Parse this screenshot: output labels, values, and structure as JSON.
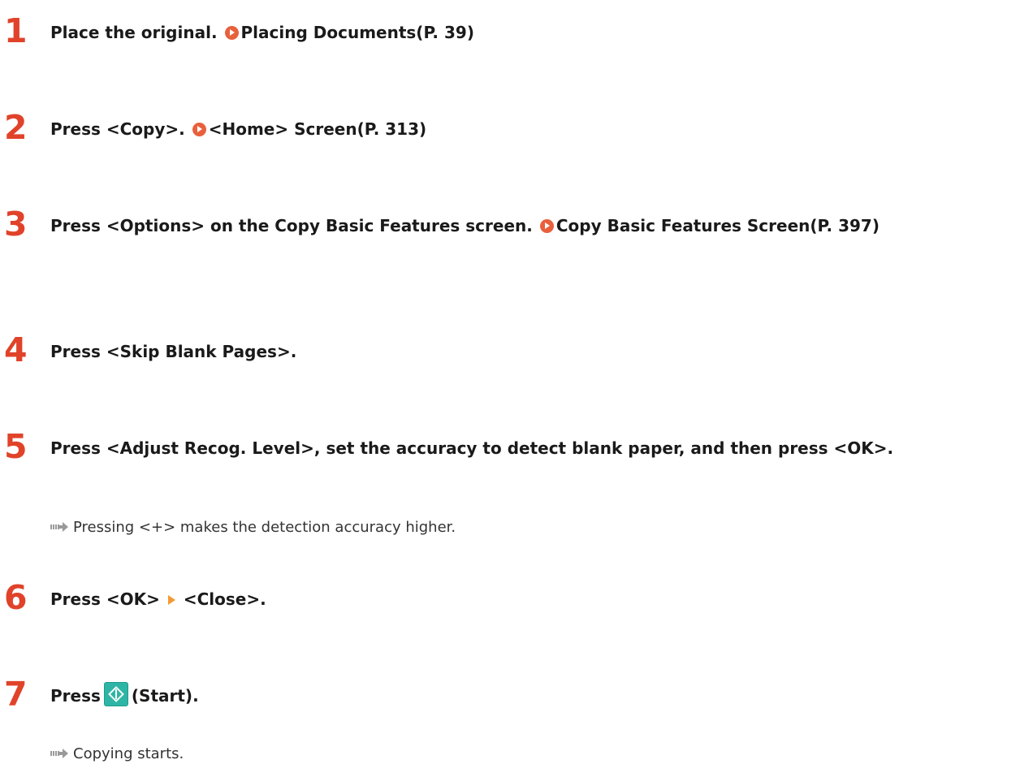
{
  "steps": [
    {
      "number": "1",
      "text": "Place the original.",
      "link": "Placing Documents(P. 39)"
    },
    {
      "number": "2",
      "text": "Press <Copy>.",
      "link": "<Home> Screen(P. 313)"
    },
    {
      "number": "3",
      "text": "Press <Options> on the Copy Basic Features screen.",
      "link": "Copy Basic Features Screen(P. 397)"
    },
    {
      "number": "4",
      "text": "Press <Skip Blank Pages>."
    },
    {
      "number": "5",
      "text": "Press <Adjust Recog. Level>, set the accuracy to detect blank paper, and then press <OK>.",
      "result": "Pressing <+> makes the detection accuracy higher."
    },
    {
      "number": "6",
      "part1": "Press <OK>",
      "part2": "<Close>."
    },
    {
      "number": "7",
      "part1": "Press",
      "part2": "(Start).",
      "result": "Copying starts."
    }
  ],
  "icons": {
    "link": "link-arrow-icon",
    "menu_separator": "menu-separator-icon",
    "start": "start-key-icon",
    "result": "result-arrow-icon"
  },
  "colors": {
    "step_number": "#e0432a",
    "link_icon": "#e8603c",
    "separator": "#f29a35",
    "start_key": "#2eb5a5"
  }
}
